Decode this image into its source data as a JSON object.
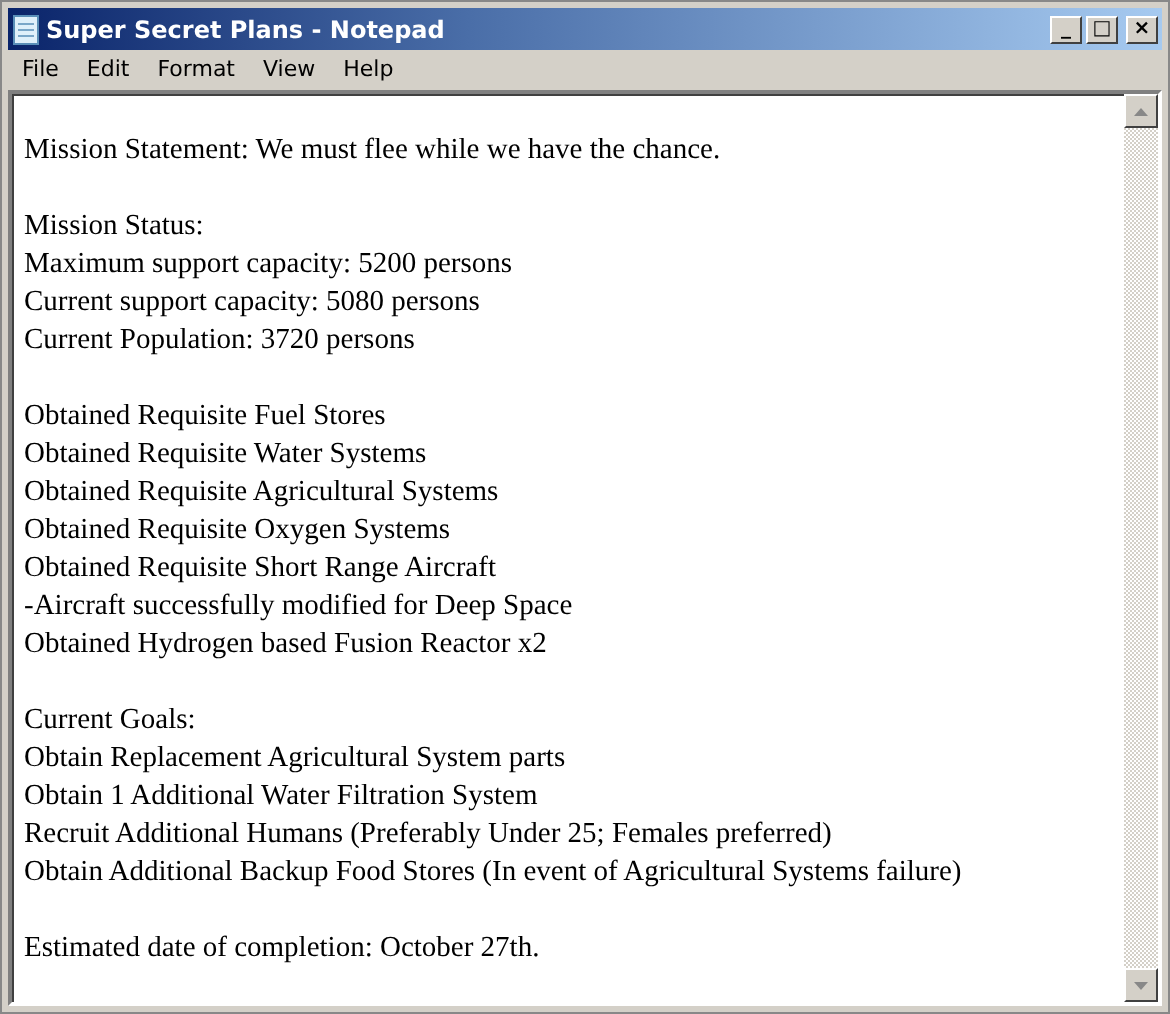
{
  "window": {
    "title": "Super Secret Plans - Notepad",
    "controls": [
      "_",
      "□",
      "×"
    ]
  },
  "menu": [
    "File",
    "Edit",
    "Format",
    "View",
    "Help"
  ],
  "document": {
    "paragraphs": [
      [
        "Mission Statement: We must flee while we have the chance."
      ],
      [
        "Mission Status:",
        "Maximum support capacity: 5200 persons",
        "Current support capacity: 5080 persons",
        "Current Population: 3720 persons"
      ],
      [
        "Obtained Requisite Fuel Stores",
        "Obtained Requisite Water Systems",
        "Obtained Requisite Agricultural Systems",
        "Obtained Requisite Oxygen Systems",
        "Obtained Requisite Short Range Aircraft",
        "-Aircraft successfully modified for Deep Space",
        "Obtained Hydrogen based Fusion Reactor x2"
      ],
      [
        "Current Goals:",
        "Obtain Replacement Agricultural System parts",
        "Obtain 1 Additional Water Filtration System",
        "Recruit Additional Humans (Preferably Under 25; Females preferred)",
        "Obtain Additional Backup Food Stores (In event of Agricultural Systems failure)"
      ],
      [
        "Estimated date of completion: October 27th."
      ]
    ]
  }
}
